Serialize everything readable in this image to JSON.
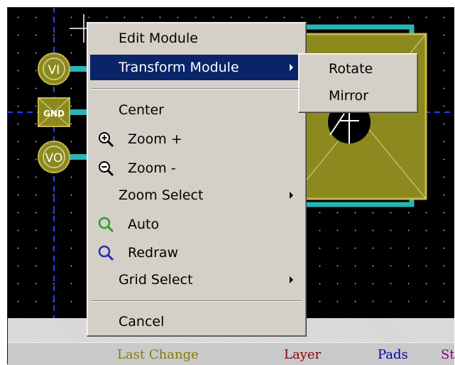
{
  "context_menu": {
    "items": [
      {
        "label": "Edit Module"
      },
      {
        "label": "Transform Module"
      },
      {
        "label": "Center"
      },
      {
        "label": "Zoom +"
      },
      {
        "label": "Zoom -"
      },
      {
        "label": "Zoom Select"
      },
      {
        "label": "Auto"
      },
      {
        "label": "Redraw"
      },
      {
        "label": "Grid Select"
      },
      {
        "label": "Cancel"
      }
    ],
    "highlighted_item": "Transform Module"
  },
  "submenu": {
    "items": [
      {
        "label": "Rotate"
      },
      {
        "label": "Mirror"
      }
    ]
  },
  "board": {
    "pads": [
      {
        "label": "VI"
      },
      {
        "label": "GND"
      },
      {
        "label": "VO"
      }
    ]
  },
  "status_bar": {
    "last_change": "Last Change",
    "layer": "Layer",
    "pads": "Pads",
    "clipped": "St"
  },
  "colors": {
    "canvas_background": "#000000",
    "track": "#2ab4b4",
    "pad_fill": "#8c8a1e",
    "pad_outline": "#c8b84a",
    "axis": "#0000ff",
    "menu_highlight": "#0a246a",
    "status_last_change": "#8a7a10",
    "status_layer": "#8b0000",
    "status_pads": "#0000a0",
    "status_clipped": "#8b008b"
  }
}
